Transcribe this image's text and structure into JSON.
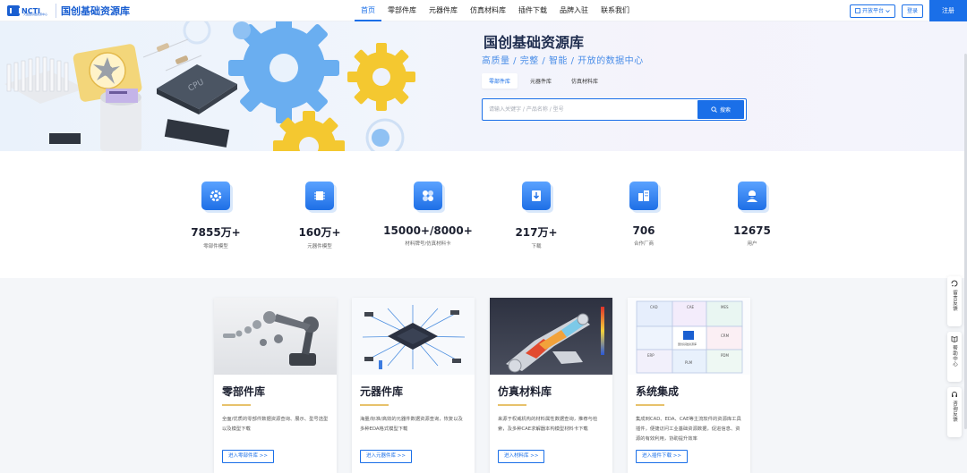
{
  "nav": {
    "logo_brand": "NCTI",
    "logo_sub": "大国国基础资源中心",
    "logo_title": "国创基础资源库",
    "menu": [
      {
        "label": "首页",
        "active": true
      },
      {
        "label": "零部件库",
        "active": false
      },
      {
        "label": "元器件库",
        "active": false
      },
      {
        "label": "仿真材料库",
        "active": false
      },
      {
        "label": "插件下载",
        "active": false
      },
      {
        "label": "品牌入驻",
        "active": false
      },
      {
        "label": "联系我们",
        "active": false
      }
    ],
    "open_platform": "开放平台",
    "login": "登录",
    "register": "注册"
  },
  "hero": {
    "title": "国创基础资源库",
    "subtitle": "高质量 / 完整 / 智能 / 开放的数据中心",
    "tabs": [
      {
        "label": "零部件库",
        "active": true
      },
      {
        "label": "元器件库",
        "active": false
      },
      {
        "label": "仿真材料库",
        "active": false
      }
    ],
    "search_placeholder": "请输入关键字 / 产品名称 / 型号",
    "search_button": "搜索",
    "cpu_text": "CPU"
  },
  "stats": [
    {
      "value": "7855万+",
      "label": "零部件模型",
      "icon": "gear-icon"
    },
    {
      "value": "160万+",
      "label": "元器件模型",
      "icon": "chip-icon"
    },
    {
      "value": "15000+/8000+",
      "label": "材料牌号/仿真材料卡",
      "icon": "material-icon"
    },
    {
      "value": "217万+",
      "label": "下载",
      "icon": "download-icon"
    },
    {
      "value": "706",
      "label": "合作厂商",
      "icon": "building-icon"
    },
    {
      "value": "12675",
      "label": "用户",
      "icon": "user-icon"
    }
  ],
  "cards": [
    {
      "title": "零部件库",
      "desc": "全面/优质的零部件数据资源查询、展示、型号选型以及模型下载",
      "button": "进入零部件库 >>"
    },
    {
      "title": "元器件库",
      "desc": "海量/标准/高效的元器件数据资源查询，恢复以及多种EDA格式模型下载",
      "button": "进入元器件库 >>"
    },
    {
      "title": "仿真材料库",
      "desc": "来源于权威机构的材料属性数据查询，推荐与检索，及多种CAE求解器本构模型材料卡下载",
      "button": "进入材料库 >>"
    },
    {
      "title": "系统集成",
      "desc": "集成到CAD、EDA、CAE等主流软件的资源库工具插件，便捷访问工业基础资源数据，促进信息、资源的有效利用，协助提升效率",
      "button": "进入插件下载 >>"
    }
  ],
  "puzzle_labels": [
    "CAD",
    "CAE",
    "MES",
    "CRM",
    "ERP",
    "PLM",
    "PDM",
    "国创基础资源库"
  ],
  "side": [
    {
      "label": "留言反馈",
      "icon": "feedback-icon"
    },
    {
      "label": "帮助中心",
      "icon": "book-icon"
    },
    {
      "label": "咨询反馈",
      "icon": "headset-icon"
    }
  ]
}
